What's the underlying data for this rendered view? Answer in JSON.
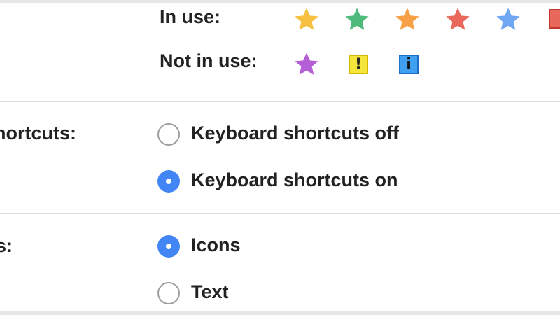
{
  "stars": {
    "in_use_label": "In use:",
    "not_in_use_label": "Not in use:",
    "in_use_colors": [
      "#f6c142",
      "#4fbb7a",
      "#f7a046",
      "#e8685b",
      "#6fa7f2"
    ],
    "in_use_partial_color": "#e8685b",
    "not_in_use": {
      "star_color": "#b45fd6",
      "yellow_bang": {
        "symbol": "!",
        "bg": "#f6e53a",
        "border": "#d4b700"
      },
      "blue_info": {
        "symbol": "i",
        "bg": "#3f9ff0",
        "border": "#1e6fc5"
      }
    }
  },
  "keyboard_shortcuts": {
    "label": "hortcuts:",
    "options": [
      {
        "label": "Keyboard shortcuts off",
        "selected": false
      },
      {
        "label": "Keyboard shortcuts on",
        "selected": true
      }
    ]
  },
  "button_labels": {
    "label": "s:",
    "options": [
      {
        "label": "Icons",
        "selected": true
      },
      {
        "label": "Text",
        "selected": false
      }
    ]
  },
  "colors": {
    "accent": "#4285f4",
    "divider": "#dcdcdc"
  }
}
